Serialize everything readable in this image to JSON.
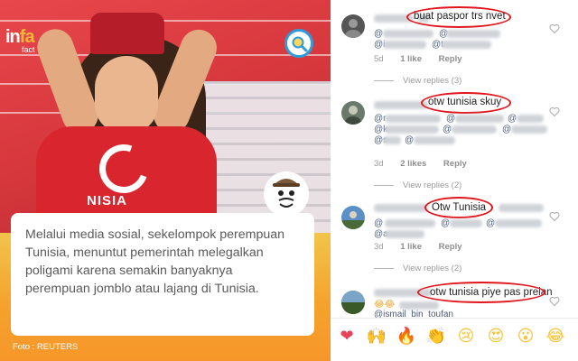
{
  "post": {
    "logo": "in",
    "logo_suffix": "fa",
    "logo_sub": "fact",
    "shirt_text": "NISIA",
    "caption": "Melalui media sosial, sekelompok perempuan Tunisia, menuntut pemerintah melegalkan poligami karena semakin banyaknya perempuan jomblo atau lajang di Tunisia.",
    "photo_credit": "Foto :  REUTERS"
  },
  "comments": [
    {
      "text": "buat paspor trs nvet",
      "mentions": [
        "@",
        "@i",
        "@",
        "@t"
      ],
      "time": "5d",
      "likes": "1 like",
      "reply": "Reply",
      "view_replies": "View replies (3)"
    },
    {
      "text": "otw tunisia skuy",
      "mentions": [
        "@r",
        "@",
        "@k",
        "@s",
        "@",
        "@",
        "@",
        "@"
      ],
      "time": "3d",
      "likes": "2 likes",
      "reply": "Reply",
      "view_replies": "View replies (2)"
    },
    {
      "text": "Otw Tunisia",
      "mentions": [
        "@",
        "@a",
        "@",
        "@"
      ],
      "time": "3d",
      "likes": "1 like",
      "reply": "Reply",
      "view_replies": "View replies (2)"
    },
    {
      "text": "otw tunisia piye pas preian",
      "mentions": [
        "@ismail_bin_toufan"
      ],
      "time": "",
      "likes": "",
      "reply": "",
      "view_replies": ""
    }
  ],
  "emoji_bar": [
    {
      "icon": "heart-icon",
      "glyph": "❤",
      "color": "#e8435a"
    },
    {
      "icon": "raised-hands-icon",
      "glyph": "🙌",
      "color": "#f6c33a"
    },
    {
      "icon": "fire-icon",
      "glyph": "🔥",
      "color": "#f4793a"
    },
    {
      "icon": "clapping-icon",
      "glyph": "👏",
      "color": "#f6c33a"
    },
    {
      "icon": "sad-face-icon",
      "glyph": "😢",
      "color": "#f6c33a"
    },
    {
      "icon": "heart-eyes-icon",
      "glyph": "😍",
      "color": "#f6c33a"
    },
    {
      "icon": "surprised-face-icon",
      "glyph": "😮",
      "color": "#f6c33a"
    },
    {
      "icon": "laughing-face-icon",
      "glyph": "😂",
      "color": "#f6c33a"
    }
  ],
  "colors": {
    "highlight": "#e0161c",
    "mention": "#4a5c7a",
    "meta": "#9a9a9a",
    "overlay": "#f4a32d"
  }
}
